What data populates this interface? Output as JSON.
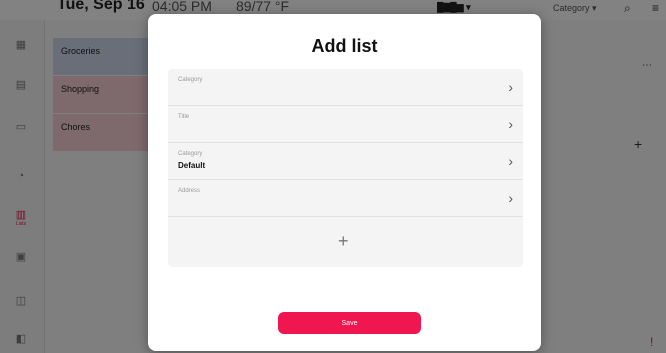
{
  "topbar": {
    "date": "Tue, Sep 16",
    "time": "04:05 PM",
    "temp": "89/77 °F",
    "account": "█▇█▆ ▾",
    "category_select": "Category ▾",
    "search_icon": "search-icon",
    "filter_icon": "filter-icon"
  },
  "rail": {
    "items": [
      {
        "icon": "▦",
        "label": ""
      },
      {
        "icon": "▤",
        "label": ""
      },
      {
        "icon": "▭",
        "label": ""
      },
      {
        "icon": "◔",
        "label": ""
      },
      {
        "icon": "▥",
        "label": "Lists"
      },
      {
        "icon": "▣",
        "label": ""
      },
      {
        "icon": "◫",
        "label": ""
      },
      {
        "icon": "◧",
        "label": ""
      }
    ]
  },
  "lists": {
    "items": [
      {
        "name": "Groceries",
        "sub": "",
        "color": "#c9d3e8"
      },
      {
        "name": "Shopping",
        "sub": "",
        "color": "#f2c9cf"
      },
      {
        "name": "Chores",
        "sub": "",
        "color": "#f2c9cf"
      }
    ]
  },
  "modal": {
    "title": "Add list",
    "fields": [
      {
        "label": "Category",
        "value": ""
      },
      {
        "label": "Title",
        "value": ""
      },
      {
        "label": "Category",
        "value": "Default"
      },
      {
        "label": "Address",
        "value": ""
      }
    ],
    "add_icon": "+",
    "chevron": "›",
    "save_label": "Save"
  },
  "colors": {
    "accent": "#f0164f",
    "modal_bg": "#ffffff",
    "field_bg": "#f4f4f4"
  }
}
